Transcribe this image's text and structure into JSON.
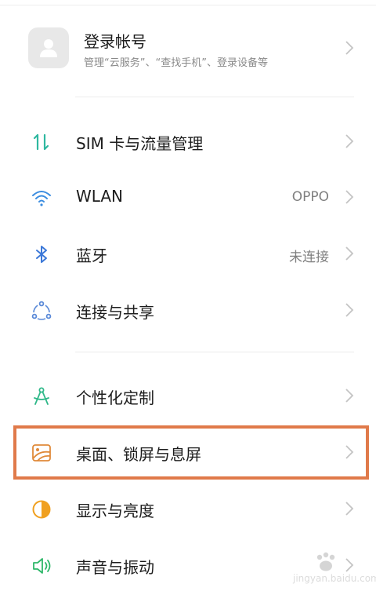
{
  "account": {
    "title": "登录帐号",
    "subtitle": "管理“云服务”、“查找手机”、登录设备等"
  },
  "rows": [
    {
      "label": "SIM 卡与流量管理",
      "value": "",
      "icon": "sim-data-icon",
      "color": "#2fb8a0"
    },
    {
      "label": "WLAN",
      "value": "OPPO",
      "icon": "wifi-icon",
      "color": "#3b8de0"
    },
    {
      "label": "蓝牙",
      "value": "未连接",
      "icon": "bluetooth-icon",
      "color": "#3b78d8"
    },
    {
      "label": "连接与共享",
      "value": "",
      "icon": "connection-share-icon",
      "color": "#5b8ad8"
    },
    {
      "label": "个性化定制",
      "value": "",
      "icon": "compass-icon",
      "color": "#2fb889"
    },
    {
      "label": "桌面、锁屏与息屏",
      "value": "",
      "icon": "wallpaper-icon",
      "color": "#e08a3a"
    },
    {
      "label": "显示与亮度",
      "value": "",
      "icon": "brightness-icon",
      "color": "#f0a020"
    },
    {
      "label": "声音与振动",
      "value": "",
      "icon": "sound-icon",
      "color": "#2fb86a"
    }
  ],
  "watermark": {
    "text": "jingyan.baidu.com"
  },
  "highlight_color": "#e07a4a"
}
